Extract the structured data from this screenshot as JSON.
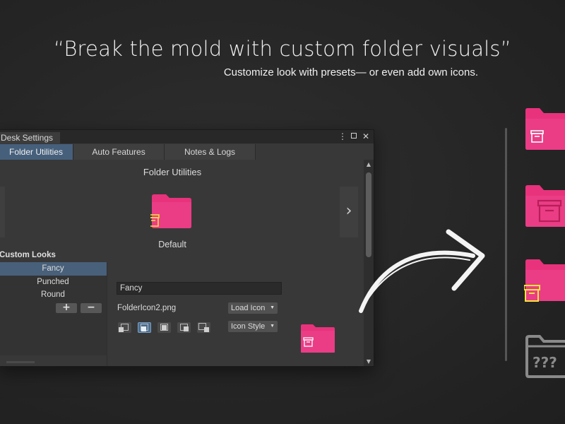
{
  "headline": "“Break the mold with custom folder visuals”",
  "subline": "Customize look with presets— or even add own icons.",
  "window": {
    "title": "Desk Settings",
    "tabs": [
      {
        "label": "Folder Utilities"
      },
      {
        "label": "Auto Features"
      },
      {
        "label": "Notes & Logs"
      }
    ],
    "section_title": "Folder Utilities",
    "preset_label": "Default",
    "list_header": "Custom Looks",
    "list_items": [
      {
        "label": "Fancy"
      },
      {
        "label": "Punched"
      },
      {
        "label": "Round"
      }
    ],
    "add_label": "+",
    "remove_label": "−",
    "name_value": "Fancy",
    "icon_file": "FolderIcon2.png",
    "load_icon_label": "Load Icon",
    "icon_style_label": "Icon Style",
    "next_glyph": "›"
  },
  "side_folders": {
    "unknown_glyph": "???"
  },
  "colors": {
    "folder_pink": "#e8327c",
    "folder_pink_dark": "#c2215f",
    "badge_yellow": "#f5e63a",
    "active_tab": "#46607c"
  }
}
